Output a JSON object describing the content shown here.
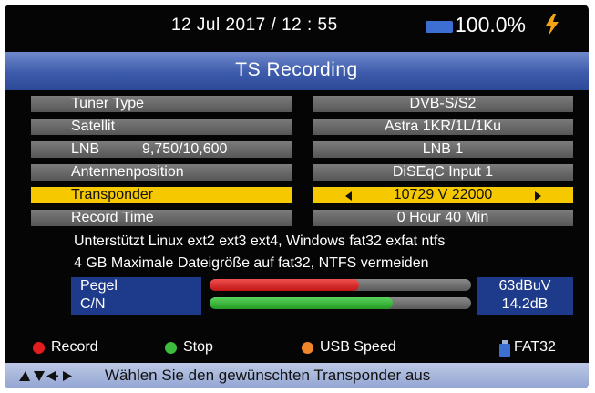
{
  "status": {
    "datetime": "12 Jul 2017 / 12 : 55",
    "battery": "100.0%",
    "battery_icon": "battery-icon",
    "charging_icon": "lightning-bolt-icon"
  },
  "header": {
    "title": "TS Recording"
  },
  "settings": [
    {
      "label": "Tuner Type",
      "value": "DVB-S/S2"
    },
    {
      "label": "Satellit",
      "value": "Astra 1KR/1L/1Ku"
    },
    {
      "label": "LNB",
      "sub": "9,750/10,600",
      "value": "LNB 1"
    },
    {
      "label": "Antennenposition",
      "value": "DiSEqC Input 1"
    },
    {
      "label": "Transponder",
      "value": "10729 V 22000",
      "selected": true
    },
    {
      "label": "Record Time",
      "value": "0 Hour 40 Min"
    }
  ],
  "info": {
    "line1": "Unterstützt Linux ext2 ext3 ext4, Windows fat32 exfat ntfs",
    "line2": "4 GB Maximale Dateigröße auf fat32, NTFS vermeiden"
  },
  "signal": {
    "pegel_label": "Pegel",
    "pegel_value": "63dBuV",
    "pegel_level": 0.57,
    "cn_label": "C/N",
    "cn_value": "14.2dB",
    "cn_level": 0.7
  },
  "legend": {
    "record": "Record",
    "stop": "Stop",
    "usb_speed": "USB Speed",
    "fat32": "FAT32",
    "colors": {
      "red": "#e31d1d",
      "green": "#3dbd3d",
      "orange": "#f0862a"
    }
  },
  "footer": {
    "hint": "Wählen Sie den gewünschten Transponder aus",
    "nav_icon": "navigation-arrows-icon"
  }
}
